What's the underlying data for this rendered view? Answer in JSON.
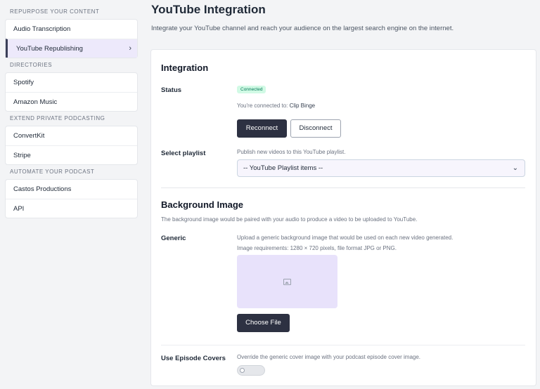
{
  "sidebar": {
    "groups": [
      {
        "heading": "REPURPOSE YOUR CONTENT",
        "items": [
          "Audio Transcription",
          "YouTube Republishing"
        ]
      },
      {
        "heading": "DIRECTORIES",
        "items": [
          "Spotify",
          "Amazon Music"
        ]
      },
      {
        "heading": "EXTEND PRIVATE PODCASTING",
        "items": [
          "ConvertKit",
          "Stripe"
        ]
      },
      {
        "heading": "AUTOMATE YOUR PODCAST",
        "items": [
          "Castos Productions",
          "API"
        ]
      }
    ],
    "active_item": "YouTube Republishing"
  },
  "header": {
    "title": "YouTube Integration",
    "subtitle": "Integrate your YouTube channel and reach your audience on the largest search engine on the internet."
  },
  "integration": {
    "section_title": "Integration",
    "status_label": "Status",
    "status_badge": "Connected",
    "connected_text": "You're connected to:",
    "connected_name": "Clip Binge",
    "reconnect_label": "Reconnect",
    "disconnect_label": "Disconnect",
    "playlist_label": "Select playlist",
    "playlist_help": "Publish new videos to this YouTube playlist.",
    "playlist_selected": "-- YouTube Playlist items --"
  },
  "background": {
    "section_title": "Background Image",
    "description": "The background image would be paired with your audio to produce a video to be uploaded to YouTube.",
    "generic_label": "Generic",
    "generic_help_1": "Upload a generic background image that would be used on each new video generated.",
    "generic_help_2": "Image requirements: 1280 × 720 pixels, file format JPG or PNG.",
    "choose_file_label": "Choose File",
    "covers_label": "Use Episode Covers",
    "covers_help": "Override the generic cover image with your podcast episode cover image.",
    "covers_enabled": false
  },
  "colors": {
    "accent_dark": "#2d3142",
    "active_bg": "#ede9fb",
    "badge_bg": "#d1fae5",
    "badge_text": "#047857"
  }
}
